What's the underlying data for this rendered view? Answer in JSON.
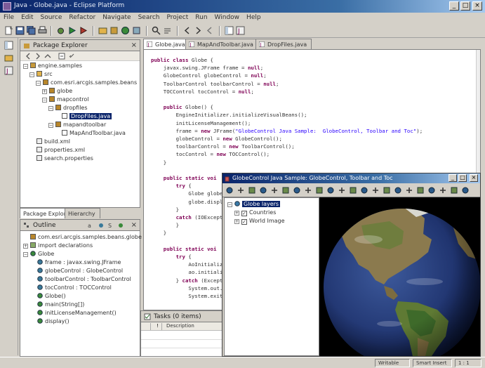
{
  "window": {
    "title": "Java - Globe.java - Eclipse Platform",
    "minimize": "_",
    "maximize": "□",
    "close": "×"
  },
  "menu": [
    "File",
    "Edit",
    "Source",
    "Refactor",
    "Navigate",
    "Search",
    "Project",
    "Run",
    "Window",
    "Help"
  ],
  "package_explorer": {
    "title": "Package Explorer",
    "close": "×",
    "items": [
      {
        "label": "engine.samples",
        "level": 0,
        "icon": "project-icon",
        "expander": "−"
      },
      {
        "label": "src",
        "level": 1,
        "icon": "folder-icon",
        "expander": "−"
      },
      {
        "label": "com.esri.arcgis.samples.beans",
        "level": 2,
        "icon": "package-icon",
        "expander": "−"
      },
      {
        "label": "globe",
        "level": 3,
        "icon": "package-icon",
        "expander": "+"
      },
      {
        "label": "mapcontrol",
        "level": 3,
        "icon": "package-icon",
        "expander": "−"
      },
      {
        "label": "dropfiles",
        "level": 4,
        "icon": "package-icon",
        "expander": "−"
      },
      {
        "label": "DropFiles.java",
        "level": 5,
        "icon": "java-file-icon",
        "expander": "",
        "selected": true
      },
      {
        "label": "mapandtoolbar",
        "level": 4,
        "icon": "package-icon",
        "expander": "−"
      },
      {
        "label": "MapAndToolbar.java",
        "level": 5,
        "icon": "java-file-icon",
        "expander": ""
      },
      {
        "label": "build.xml",
        "level": 1,
        "icon": "file-icon",
        "expander": ""
      },
      {
        "label": "properties.xml",
        "level": 1,
        "icon": "file-icon",
        "expander": ""
      },
      {
        "label": "search.properties",
        "level": 1,
        "icon": "file-icon",
        "expander": ""
      }
    ],
    "tabs": [
      "Package Explorer",
      "Hierarchy"
    ]
  },
  "outline": {
    "title": "Outline",
    "close": "×",
    "items": [
      {
        "label": "com.esri.arcgis.samples.beans.globe",
        "level": 0,
        "icon": "package-icon",
        "expander": ""
      },
      {
        "label": "import declarations",
        "level": 0,
        "icon": "import-icon",
        "expander": "+"
      },
      {
        "label": "Globe",
        "level": 0,
        "icon": "class-icon",
        "expander": "−"
      },
      {
        "label": "frame : javax.swing.JFrame",
        "level": 1,
        "icon": "field-icon",
        "expander": ""
      },
      {
        "label": "globeControl : GlobeControl",
        "level": 1,
        "icon": "field-icon",
        "expander": ""
      },
      {
        "label": "toolbarControl : ToolbarControl",
        "level": 1,
        "icon": "field-icon",
        "expander": ""
      },
      {
        "label": "tocControl : TOCControl",
        "level": 1,
        "icon": "field-icon",
        "expander": ""
      },
      {
        "label": "Globe()",
        "level": 1,
        "icon": "constructor-icon",
        "expander": ""
      },
      {
        "label": "main(String[])",
        "level": 1,
        "icon": "method-icon",
        "expander": ""
      },
      {
        "label": "initLicenseManagement()",
        "level": 1,
        "icon": "method-icon",
        "expander": ""
      },
      {
        "label": "display()",
        "level": 1,
        "icon": "method-icon",
        "expander": ""
      }
    ]
  },
  "editor": {
    "tabs": [
      {
        "label": "Globe.java",
        "active": true
      },
      {
        "label": "MapAndToolbar.java",
        "active": false
      },
      {
        "label": "DropFiles.java",
        "active": false
      }
    ],
    "lines": [
      {
        "parts": [
          [
            "kw",
            "public class "
          ],
          [
            "",
            "Globe {"
          ]
        ]
      },
      {
        "parts": [
          [
            "",
            "    javax.swing.JFrame frame = "
          ],
          [
            "kw",
            "null"
          ],
          [
            "",
            ";"
          ]
        ]
      },
      {
        "parts": [
          [
            "",
            "    GlobeControl globeControl = "
          ],
          [
            "kw",
            "null"
          ],
          [
            "",
            ";"
          ]
        ]
      },
      {
        "parts": [
          [
            "",
            "    ToolbarControl toolbarControl = "
          ],
          [
            "kw",
            "null"
          ],
          [
            "",
            ";"
          ]
        ]
      },
      {
        "parts": [
          [
            "",
            "    TOCControl tocControl = "
          ],
          [
            "kw",
            "null"
          ],
          [
            "",
            ";"
          ]
        ]
      },
      {
        "parts": [
          [
            "",
            ""
          ]
        ]
      },
      {
        "parts": [
          [
            "kw",
            "    public "
          ],
          [
            "",
            "Globe() {"
          ]
        ]
      },
      {
        "parts": [
          [
            "",
            "        EngineInitializer.initializeVisualBeans();"
          ]
        ]
      },
      {
        "parts": [
          [
            "",
            "        initLicenseManagement();"
          ]
        ]
      },
      {
        "parts": [
          [
            "",
            "        frame = "
          ],
          [
            "kw",
            "new "
          ],
          [
            "",
            "JFrame("
          ],
          [
            "str",
            "\"GlobeControl Java Sample:  GlobeControl, Toolbar and Toc\""
          ],
          [
            "",
            ");"
          ]
        ]
      },
      {
        "parts": [
          [
            "",
            "        globeControl = "
          ],
          [
            "kw",
            "new "
          ],
          [
            "",
            "GlobeControl();"
          ]
        ]
      },
      {
        "parts": [
          [
            "",
            "        toolbarControl = "
          ],
          [
            "kw",
            "new "
          ],
          [
            "",
            "ToolbarControl();"
          ]
        ]
      },
      {
        "parts": [
          [
            "",
            "        tocControl = "
          ],
          [
            "kw",
            "new "
          ],
          [
            "",
            "TOCControl();"
          ]
        ]
      },
      {
        "parts": [
          [
            "",
            "    }"
          ]
        ]
      },
      {
        "parts": [
          [
            "",
            ""
          ]
        ]
      },
      {
        "parts": [
          [
            "kw",
            "    public static voi"
          ]
        ]
      },
      {
        "parts": [
          [
            "kw",
            "        try "
          ],
          [
            "",
            "{"
          ]
        ]
      },
      {
        "parts": [
          [
            "",
            "            Globe globe ="
          ]
        ]
      },
      {
        "parts": [
          [
            "",
            "            globe.display"
          ]
        ]
      },
      {
        "parts": [
          [
            "",
            "        }"
          ]
        ]
      },
      {
        "parts": [
          [
            "kw",
            "        catch "
          ],
          [
            "",
            "(IOExcept"
          ]
        ]
      },
      {
        "parts": [
          [
            "",
            "        }"
          ]
        ]
      },
      {
        "parts": [
          [
            "",
            "    }"
          ]
        ]
      },
      {
        "parts": [
          [
            "",
            ""
          ]
        ]
      },
      {
        "parts": [
          [
            "kw",
            "    public static voi"
          ]
        ]
      },
      {
        "parts": [
          [
            "kw",
            "        try "
          ],
          [
            "",
            "{"
          ]
        ]
      },
      {
        "parts": [
          [
            "",
            "            AoInitializ"
          ]
        ]
      },
      {
        "parts": [
          [
            "",
            "            ao.initiali"
          ]
        ]
      },
      {
        "parts": [
          [
            "",
            "        } "
          ],
          [
            "kw",
            "catch "
          ],
          [
            "",
            "(Except"
          ]
        ]
      },
      {
        "parts": [
          [
            "",
            "            System.out."
          ]
        ]
      },
      {
        "parts": [
          [
            "",
            "            System.exit"
          ]
        ]
      }
    ]
  },
  "tasks": {
    "title": "Tasks (0 items)",
    "columns": [
      "",
      "!",
      "Description"
    ]
  },
  "globe_window": {
    "title": "GlobeControl Java Sample:  GlobeControl, Toolbar and Toc",
    "toc": [
      {
        "label": "Globe layers",
        "level": 0,
        "expander": "−",
        "checked": false,
        "selected": true
      },
      {
        "label": "Countries",
        "level": 1,
        "expander": "+",
        "checked": true
      },
      {
        "label": "World Image",
        "level": 1,
        "expander": "+",
        "checked": true
      }
    ]
  },
  "status": [
    "Writable",
    "Smart Insert",
    "1 : 1"
  ]
}
